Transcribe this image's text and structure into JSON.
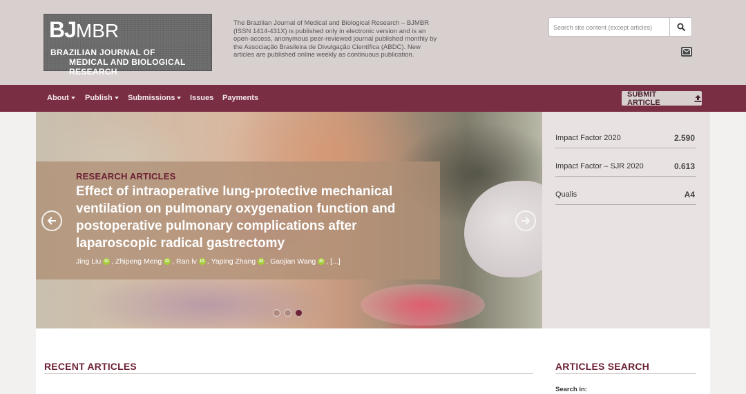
{
  "header": {
    "logo_mark": "BJ",
    "logo_mark_sub": "MBR",
    "logo_line1": "BRAZILIAN JOURNAL OF",
    "logo_line2": "MEDICAL AND BIOLOGICAL RESEARCH",
    "about": "The Brazilian Journal of Medical and Biological Research – BJMBR (ISSN 1414-431X) is published only in electronic version and is an open-access, anonymous peer-reviewed journal published monthly by the Associação Brasileira de Divulgação Científica (ABDC). New articles are published online weekly as continuous publication.",
    "search_placeholder": "Search site content (except articles)"
  },
  "nav": {
    "items": [
      {
        "label": "About",
        "dropdown": true
      },
      {
        "label": "Publish",
        "dropdown": true
      },
      {
        "label": "Submissions",
        "dropdown": true
      },
      {
        "label": "Issues",
        "dropdown": false
      },
      {
        "label": "Payments",
        "dropdown": false
      }
    ],
    "submit_label": "SUBMIT ARTICLE"
  },
  "hero": {
    "kicker": "RESEARCH ARTICLES",
    "title": "Effect of intraoperative lung-protective mechanical ventilation on pulmonary oxygenation function and postoperative pulmonary complications after laparoscopic radical gastrectomy",
    "authors": [
      "Jing Liu",
      "Zhipeng Meng",
      "Ran lv",
      "Yaping Zhang",
      "Gaojian Wang"
    ],
    "authors_more": "[...]",
    "orcid_glyph": "iD",
    "slides_total": 3,
    "slide_active": 3
  },
  "metrics": [
    {
      "label": "Impact Factor 2020",
      "value": "2.590"
    },
    {
      "label": "Impact Factor – SJR 2020",
      "value": "0.613"
    },
    {
      "label": "Qualis",
      "value": "A4"
    }
  ],
  "sections": {
    "recent": "RECENT ARTICLES",
    "search": "ARTICLES SEARCH",
    "search_in": "Search in:"
  },
  "colors": {
    "brand": "#7a2e44",
    "header_bg": "#d8cfcf",
    "accent_text": "#6d2134",
    "orcid": "#a6ce39"
  }
}
